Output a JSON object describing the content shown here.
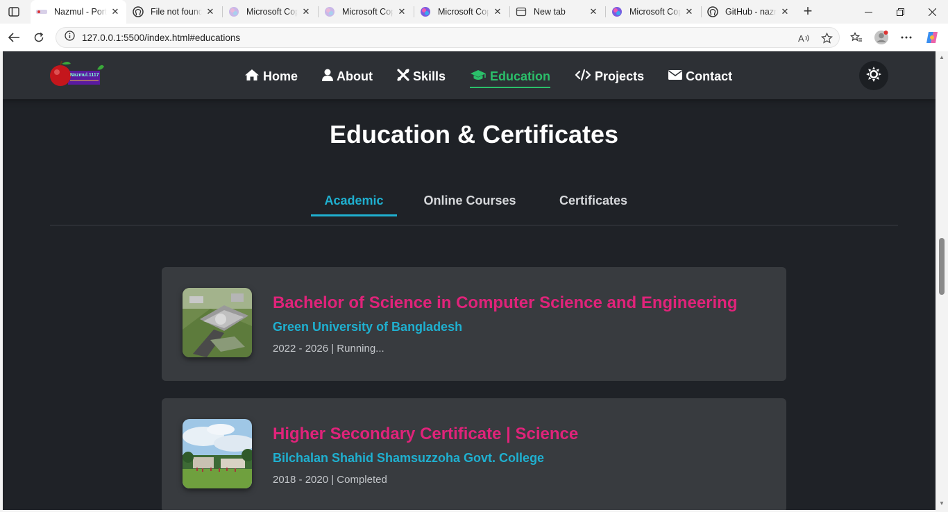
{
  "browser": {
    "tabs": [
      {
        "title": "Nazmul - Portfolio",
        "icon": "portfolio-favicon",
        "active": true
      },
      {
        "title": "File not found",
        "icon": "github-icon",
        "active": false
      },
      {
        "title": "Microsoft Copilot",
        "icon": "copilot-icon",
        "active": false
      },
      {
        "title": "Microsoft Copilot",
        "icon": "copilot-icon",
        "active": false
      },
      {
        "title": "Microsoft Copilot",
        "icon": "copilot-icon",
        "active": false
      },
      {
        "title": "New tab",
        "icon": "new-tab-page-icon",
        "active": false
      },
      {
        "title": "Microsoft Copilot",
        "icon": "copilot-icon",
        "active": false
      },
      {
        "title": "GitHub - nazmul",
        "icon": "github-icon",
        "active": false
      }
    ],
    "url": "127.0.0.1:5500/index.html#educations",
    "colors": {
      "chrome": "#f3f3f3",
      "active_tab": "#ffffff"
    }
  },
  "site": {
    "logo_text": "Nazmul.1117",
    "nav": [
      {
        "label": "Home",
        "icon": "home-icon",
        "active": false
      },
      {
        "label": "About",
        "icon": "user-icon",
        "active": false
      },
      {
        "label": "Skills",
        "icon": "tools-icon",
        "active": false
      },
      {
        "label": "Education",
        "icon": "graduation-cap-icon",
        "active": true
      },
      {
        "label": "Projects",
        "icon": "code-icon",
        "active": false
      },
      {
        "label": "Contact",
        "icon": "envelope-icon",
        "active": false
      }
    ],
    "theme_toggle_icon": "sun-icon",
    "colors": {
      "background": "#1f2227",
      "header": "#2d3035",
      "card": "#383b3f",
      "accent_green": "#2bbf6a",
      "accent_cyan": "#1fb0d0",
      "accent_pink": "#e0237a"
    }
  },
  "section": {
    "title": "Education & Certificates",
    "tabs": [
      {
        "label": "Academic",
        "active": true
      },
      {
        "label": "Online Courses",
        "active": false
      },
      {
        "label": "Certificates",
        "active": false
      }
    ]
  },
  "education": [
    {
      "degree": "Bachelor of Science in Computer Science and Engineering",
      "institution": "Green University of Bangladesh",
      "duration": "2022 - 2026 | Running..."
    },
    {
      "degree": "Higher Secondary Certificate | Science",
      "institution": "Bilchalan Shahid Shamsuzzoha Govt. College",
      "duration": "2018 - 2020 | Completed"
    }
  ]
}
